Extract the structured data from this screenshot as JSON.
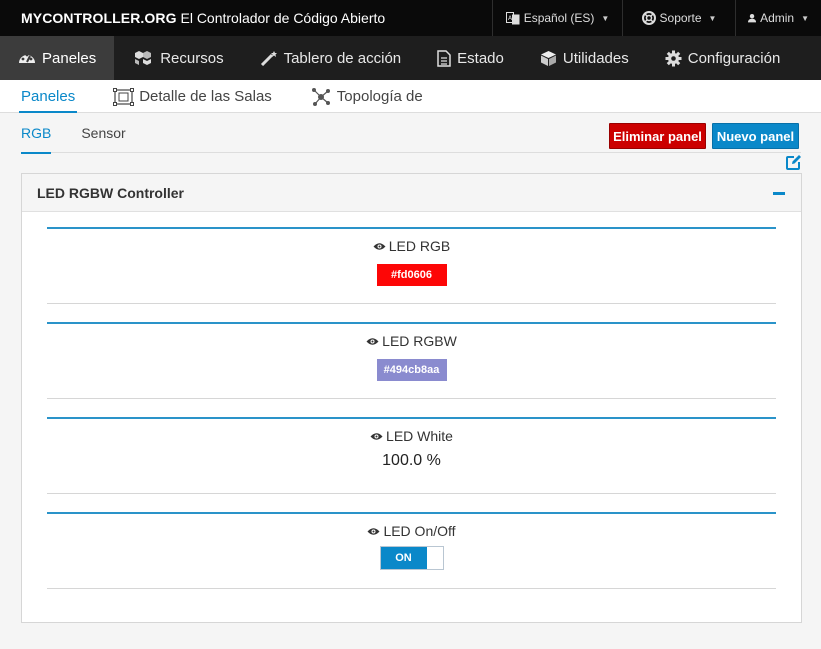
{
  "brand": {
    "name": "MYCONTROLLER.ORG",
    "tagline": "El Controlador de Código Abierto"
  },
  "topbar": {
    "language": "Español (ES)",
    "support": "Soporte",
    "user": "Admin"
  },
  "mainnav": {
    "items": [
      {
        "label": "Paneles",
        "icon": "dashboard-icon",
        "active": true
      },
      {
        "label": "Recursos",
        "icon": "cubes-icon"
      },
      {
        "label": "Tablero de acción",
        "icon": "magic-wand-icon"
      },
      {
        "label": "Estado",
        "icon": "document-icon"
      },
      {
        "label": "Utilidades",
        "icon": "box-icon"
      },
      {
        "label": "Configuración",
        "icon": "gear-icon"
      }
    ]
  },
  "subnav": {
    "items": [
      {
        "label": "Paneles",
        "active": true
      },
      {
        "label": "Detalle de las Salas",
        "icon": "rooms-icon"
      },
      {
        "label": "Topología de",
        "icon": "topology-icon"
      }
    ]
  },
  "tabs": [
    {
      "label": "RGB",
      "active": true
    },
    {
      "label": "Sensor"
    }
  ],
  "buttons": {
    "delete": "Eliminar panel",
    "new": "Nuevo panel"
  },
  "panel": {
    "title": "LED RGBW Controller",
    "items": [
      {
        "label": "LED RGB",
        "type": "color",
        "value": "#fd0606"
      },
      {
        "label": "LED RGBW",
        "type": "color",
        "value": "#494cb8aa"
      },
      {
        "label": "LED White",
        "type": "value",
        "value": "100.0 %"
      },
      {
        "label": "LED On/Off",
        "type": "toggle",
        "value": "ON"
      }
    ]
  },
  "colors": {
    "accent": "#0a88c9",
    "danger": "#cc0000",
    "topbar_bg": "#0a0a0a",
    "nav_bg": "#1e1e1e",
    "swatch_rgb": "#fd0606",
    "swatch_rgbw": "#8a8bcf"
  }
}
